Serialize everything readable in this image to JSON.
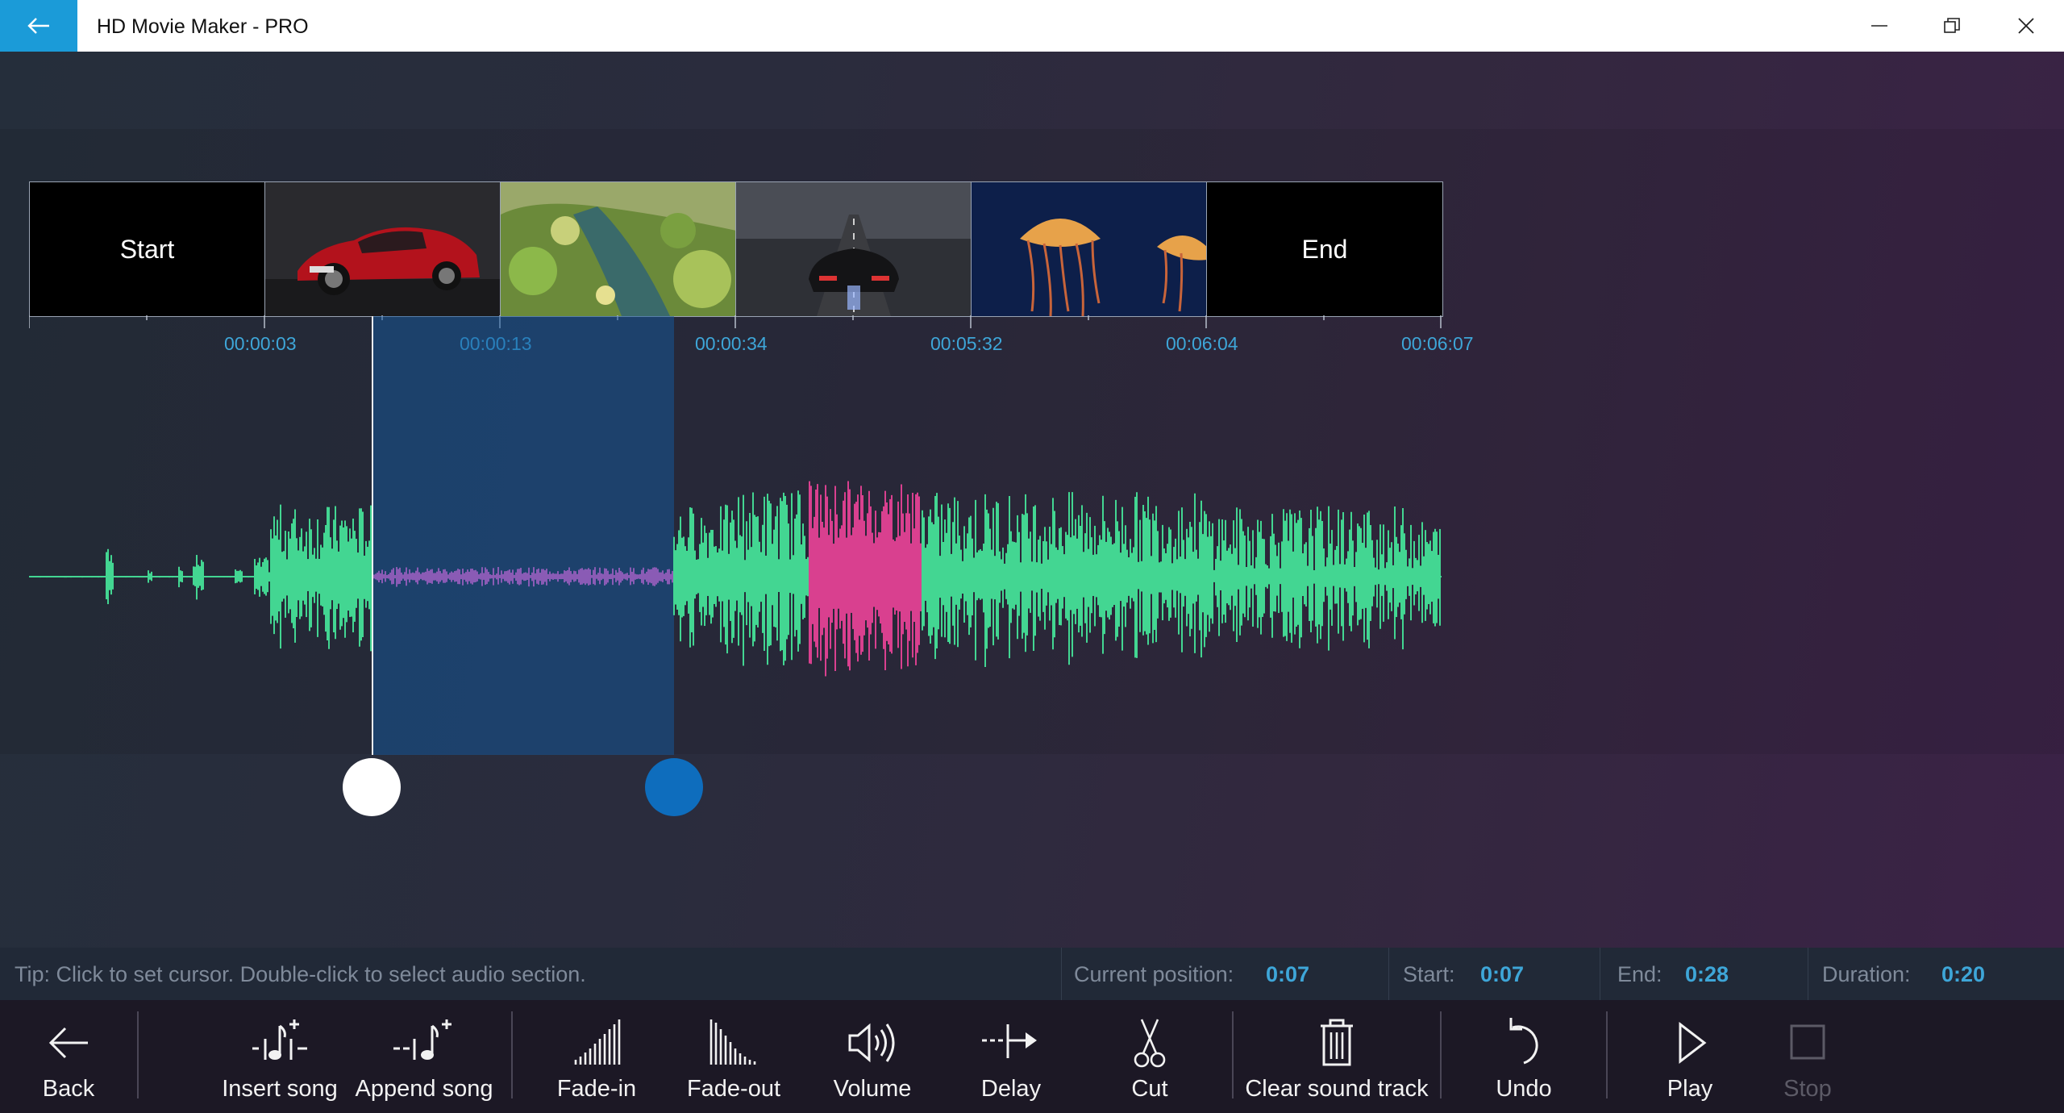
{
  "window": {
    "title": "HD Movie Maker - PRO",
    "controls": [
      "minimize",
      "restore",
      "close"
    ]
  },
  "timeline": {
    "start_label": "Start",
    "end_label": "End",
    "clips": [
      {
        "name": "red-car-clip"
      },
      {
        "name": "stream-landscape-clip"
      },
      {
        "name": "sports-car-road-clip"
      },
      {
        "name": "jellyfish-clip"
      }
    ],
    "time_labels": [
      "00:00:03",
      "00:00:13",
      "00:00:34",
      "00:05:32",
      "00:06:04",
      "00:06:07"
    ]
  },
  "waveform": {
    "colors": {
      "audio": "#43d692",
      "selected": "#8a5bb5",
      "highlight": "#d9408f",
      "selection_overlay": "#1a5a9f"
    }
  },
  "status": {
    "tip": "Tip: Click to set cursor. Double-click to select audio section.",
    "current_position_label": "Current position:",
    "current_position": "0:07",
    "start_label": "Start:",
    "start": "0:07",
    "end_label": "End:",
    "end": "0:28",
    "duration_label": "Duration:",
    "duration": "0:20"
  },
  "toolbar": {
    "back": "Back",
    "insert_song": "Insert song",
    "append_song": "Append song",
    "fade_in": "Fade-in",
    "fade_out": "Fade-out",
    "volume": "Volume",
    "delay": "Delay",
    "cut": "Cut",
    "clear_sound_track": "Clear sound track",
    "undo": "Undo",
    "play": "Play",
    "stop": "Stop"
  },
  "accent_color": "#1b9bd8"
}
